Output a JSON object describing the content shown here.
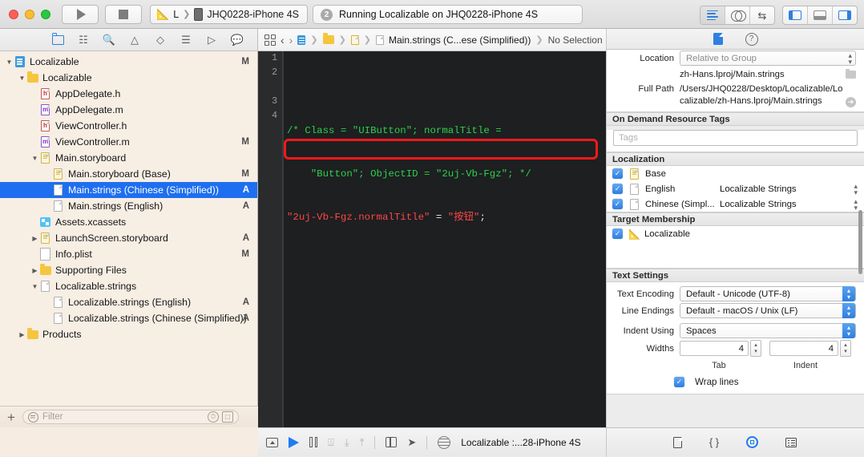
{
  "titlebar": {
    "run_button": "run-icon",
    "stop_button": "stop-icon",
    "scheme_app": "L",
    "scheme_device": "JHQ0228-iPhone 4S",
    "activity_badge": "2",
    "activity_text": "Running Localizable on JHQ0228-iPhone 4S",
    "editor_modes": [
      "standard-editor-icon",
      "assistant-editor-icon",
      "version-editor-icon"
    ],
    "panel_toggles": [
      "navigator-toggle-icon",
      "debug-area-toggle-icon",
      "utilities-toggle-icon"
    ]
  },
  "navigator": {
    "tabs": [
      "project-navigator-icon",
      "symbol-navigator-icon",
      "find-navigator-icon",
      "issue-navigator-icon",
      "test-navigator-icon",
      "debug-navigator-icon",
      "breakpoint-navigator-icon",
      "report-navigator-icon"
    ],
    "items": [
      {
        "label": "Localizable",
        "indent": 0,
        "disc": "▼",
        "icon": "project-icon",
        "status": "M",
        "selected": false
      },
      {
        "label": "Localizable",
        "indent": 1,
        "disc": "▼",
        "icon": "folder-icon",
        "status": "",
        "selected": false
      },
      {
        "label": "AppDelegate.h",
        "indent": 2,
        "disc": "",
        "icon": "header-file-icon",
        "status": "",
        "selected": false
      },
      {
        "label": "AppDelegate.m",
        "indent": 2,
        "disc": "",
        "icon": "source-file-icon",
        "status": "",
        "selected": false
      },
      {
        "label": "ViewController.h",
        "indent": 2,
        "disc": "",
        "icon": "header-file-icon",
        "status": "",
        "selected": false
      },
      {
        "label": "ViewController.m",
        "indent": 2,
        "disc": "",
        "icon": "source-file-icon",
        "status": "M",
        "selected": false
      },
      {
        "label": "Main.storyboard",
        "indent": 2,
        "disc": "▼",
        "icon": "storyboard-icon",
        "status": "",
        "selected": false
      },
      {
        "label": "Main.storyboard (Base)",
        "indent": 3,
        "disc": "",
        "icon": "storyboard-icon",
        "status": "M",
        "selected": false
      },
      {
        "label": "Main.strings (Chinese (Simplified))",
        "indent": 3,
        "disc": "",
        "icon": "strings-file-icon",
        "status": "A",
        "selected": true
      },
      {
        "label": "Main.strings (English)",
        "indent": 3,
        "disc": "",
        "icon": "strings-file-icon",
        "status": "A",
        "selected": false
      },
      {
        "label": "Assets.xcassets",
        "indent": 2,
        "disc": "",
        "icon": "xcassets-icon",
        "status": "",
        "selected": false
      },
      {
        "label": "LaunchScreen.storyboard",
        "indent": 2,
        "disc": "▶",
        "icon": "storyboard-icon",
        "status": "A",
        "selected": false
      },
      {
        "label": "Info.plist",
        "indent": 2,
        "disc": "",
        "icon": "plist-icon",
        "status": "M",
        "selected": false
      },
      {
        "label": "Supporting Files",
        "indent": 2,
        "disc": "▶",
        "icon": "folder-icon",
        "status": "",
        "selected": false
      },
      {
        "label": "Localizable.strings",
        "indent": 2,
        "disc": "▼",
        "icon": "strings-file-icon",
        "status": "",
        "selected": false
      },
      {
        "label": "Localizable.strings (English)",
        "indent": 3,
        "disc": "",
        "icon": "strings-file-icon",
        "status": "A",
        "selected": false
      },
      {
        "label": "Localizable.strings (Chinese (Simplified))",
        "indent": 3,
        "disc": "",
        "icon": "strings-file-icon",
        "status": "A",
        "selected": false
      },
      {
        "label": "Products",
        "indent": 1,
        "disc": "▶",
        "icon": "folder-icon",
        "status": "",
        "selected": false
      }
    ],
    "filter_placeholder": "Filter",
    "add_button": "+"
  },
  "editor": {
    "breadcrumb": [
      "Main.strings (C...ese (Simplified))",
      "No Selection"
    ],
    "line_numbers": [
      "1",
      "2",
      "3",
      "4"
    ],
    "code": {
      "line2a_comment": "/* Class = \"UIButton\"; normalTitle =",
      "line2b_comment": "    \"Button\"; ObjectID = \"2uj-Vb-Fgz\"; */",
      "line3_key": "\"2uj-Vb-Fgz.normalTitle\"",
      "line3_eq": " = ",
      "line3_value": "\"按钮\"",
      "line3_semi": ";"
    },
    "highlight_color": "#f21a1a",
    "comment_color": "#2dd04a",
    "string_color": "#ff4646",
    "background_color": "#1d1f21"
  },
  "inspector": {
    "tabs": [
      "file-inspector-icon",
      "quick-help-icon"
    ],
    "identity_and_type": {
      "location_label": "Location",
      "location_value": "Relative to Group",
      "relative_path": "zh-Hans.lproj/Main.strings",
      "full_path_label": "Full Path",
      "full_path_value": "/Users/JHQ0228/Desktop/Localizable/Localizable/zh-Hans.lproj/Main.strings"
    },
    "on_demand": {
      "header": "On Demand Resource Tags",
      "tags_placeholder": "Tags"
    },
    "localization": {
      "header": "Localization",
      "rows": [
        {
          "checked": true,
          "name": "Base",
          "type": "",
          "icon": "storyboard-icon"
        },
        {
          "checked": true,
          "name": "English",
          "type": "Localizable Strings",
          "icon": "strings-file-icon"
        },
        {
          "checked": true,
          "name": "Chinese (Simpl...",
          "type": "Localizable Strings",
          "icon": "strings-file-icon"
        }
      ]
    },
    "target_membership": {
      "header": "Target Membership",
      "rows": [
        {
          "checked": true,
          "name": "Localizable",
          "icon": "target-icon"
        }
      ]
    },
    "text_settings": {
      "header": "Text Settings",
      "text_encoding_label": "Text Encoding",
      "text_encoding_value": "Default - Unicode (UTF-8)",
      "line_endings_label": "Line Endings",
      "line_endings_value": "Default - macOS / Unix (LF)",
      "indent_using_label": "Indent Using",
      "indent_using_value": "Spaces",
      "widths_label": "Widths",
      "tab_width": "4",
      "indent_width": "4",
      "tab_sublabel": "Tab",
      "indent_sublabel": "Indent",
      "wrap_lines_label": "Wrap lines",
      "wrap_lines_checked": true
    }
  },
  "debugbar": {
    "icons": [
      "hide-debug-area-icon",
      "continue-icon",
      "step-over-icon",
      "step-into-icon",
      "step-out-icon",
      "step-up-icon",
      "view-hierarchy-icon",
      "location-icon"
    ],
    "process_text": "Localizable :...28-iPhone 4S"
  },
  "inspector_bottom": {
    "icons": [
      "file-template-library-icon",
      "code-snippet-library-icon",
      "object-library-icon",
      "media-library-icon"
    ]
  },
  "colors": {
    "accent": "#2f7fe0",
    "selection": "#1e6fef",
    "navigator_bg": "#f7eee4",
    "editor_bg": "#1d1f21",
    "highlight": "#f21a1a"
  }
}
